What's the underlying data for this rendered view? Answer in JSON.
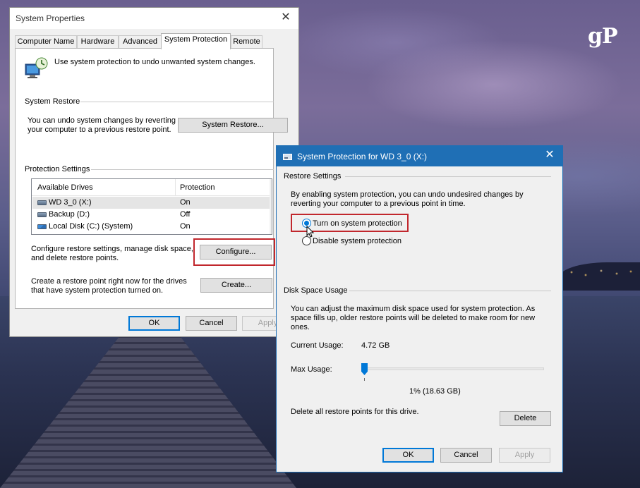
{
  "desktop": {
    "logo_text": "gP"
  },
  "system_properties": {
    "title": "System Properties",
    "tabs": [
      "Computer Name",
      "Hardware",
      "Advanced",
      "System Protection",
      "Remote"
    ],
    "active_tab": "System Protection",
    "intro": "Use system protection to undo unwanted system changes.",
    "system_restore": {
      "heading": "System Restore",
      "description": "You can undo system changes by reverting your computer to a previous restore point.",
      "button": "System Restore..."
    },
    "protection_settings": {
      "heading": "Protection Settings",
      "columns": [
        "Available Drives",
        "Protection"
      ],
      "drives": [
        {
          "name": "WD 3_0 (X:)",
          "protection": "On",
          "icon": "usb-drive-icon",
          "selected": true
        },
        {
          "name": "Backup (D:)",
          "protection": "Off",
          "icon": "drive-icon",
          "selected": false
        },
        {
          "name": "Local Disk (C:) (System)",
          "protection": "On",
          "icon": "windows-drive-icon",
          "selected": false
        }
      ],
      "configure_text": "Configure restore settings, manage disk space, and delete restore points.",
      "configure_button": "Configure...",
      "create_text": "Create a restore point right now for the drives that have system protection turned on.",
      "create_button": "Create..."
    },
    "buttons": {
      "ok": "OK",
      "cancel": "Cancel",
      "apply": "Apply"
    }
  },
  "protection_dialog": {
    "title": "System Protection for WD 3_0 (X:)",
    "restore_settings": {
      "heading": "Restore Settings",
      "description": "By enabling system protection, you can undo undesired changes by reverting your computer to a previous point in time.",
      "options": [
        "Turn on system protection",
        "Disable system protection"
      ],
      "selected": "Turn on system protection"
    },
    "disk_space": {
      "heading": "Disk Space Usage",
      "description": "You can adjust the maximum disk space used for system protection. As space fills up, older restore points will be deleted to make room for new ones.",
      "current_label": "Current Usage:",
      "current_value": "4.72 GB",
      "max_label": "Max Usage:",
      "max_value_text": "1% (18.63 GB)",
      "max_percent": 1,
      "delete_text": "Delete all restore points for this drive.",
      "delete_button": "Delete"
    },
    "buttons": {
      "ok": "OK",
      "cancel": "Cancel",
      "apply": "Apply"
    }
  },
  "colors": {
    "accent": "#0078d7",
    "highlight_box": "#c1272d",
    "dialog_titlebar": "#1f6fb5"
  }
}
